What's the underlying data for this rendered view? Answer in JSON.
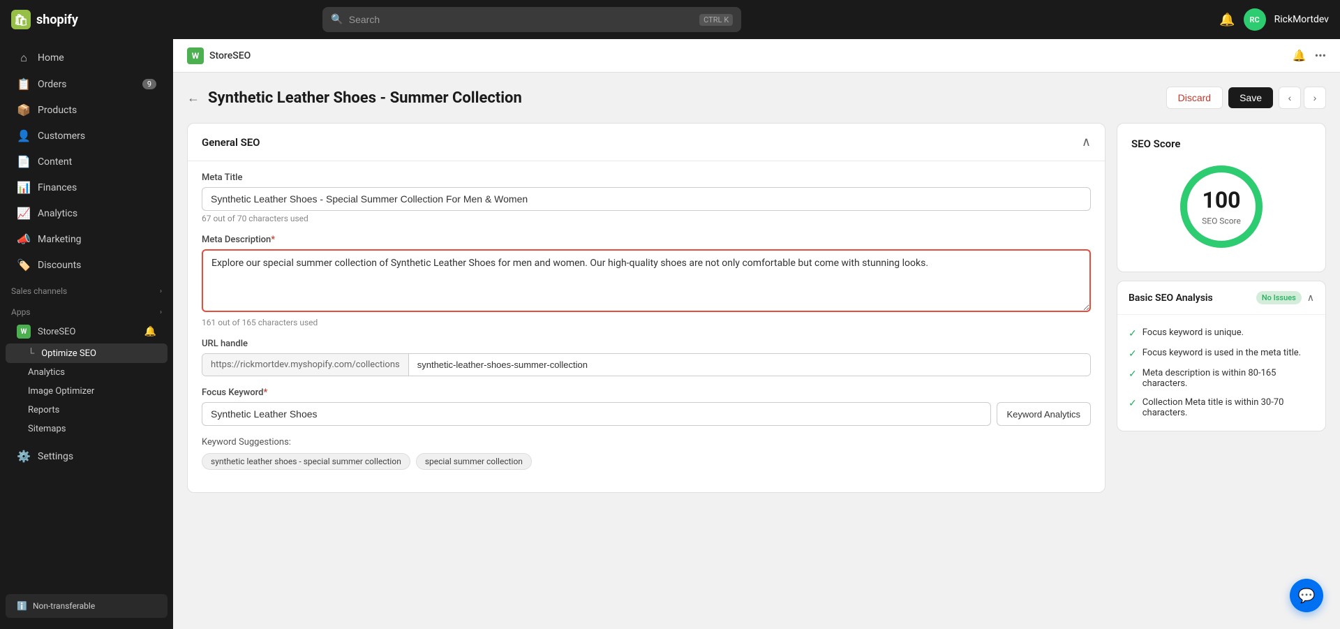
{
  "topbar": {
    "logo_text": "shopify",
    "search_placeholder": "Search",
    "search_shortcut_1": "CTRL",
    "search_shortcut_2": "K",
    "username": "RickMortdev"
  },
  "sidebar": {
    "items": [
      {
        "label": "Home",
        "icon": "⌂",
        "badge": null
      },
      {
        "label": "Orders",
        "icon": "📋",
        "badge": "9"
      },
      {
        "label": "Products",
        "icon": "📦",
        "badge": null
      },
      {
        "label": "Customers",
        "icon": "👤",
        "badge": null
      },
      {
        "label": "Content",
        "icon": "📄",
        "badge": null
      },
      {
        "label": "Finances",
        "icon": "📊",
        "badge": null
      },
      {
        "label": "Analytics",
        "icon": "📈",
        "badge": null
      },
      {
        "label": "Marketing",
        "icon": "📣",
        "badge": null
      },
      {
        "label": "Discounts",
        "icon": "🏷️",
        "badge": null
      }
    ],
    "sales_channels_label": "Sales channels",
    "apps_label": "Apps",
    "store_seo_label": "StoreSEO",
    "sub_items": [
      {
        "label": "Optimize SEO",
        "active": true
      },
      {
        "label": "Analytics",
        "active": false
      },
      {
        "label": "Image Optimizer",
        "active": false
      },
      {
        "label": "Reports",
        "active": false
      },
      {
        "label": "Sitemaps",
        "active": false
      }
    ],
    "settings_label": "Settings",
    "non_transferable_label": "Non-transferable"
  },
  "app_header": {
    "title": "StoreSEO",
    "icon_text": "W"
  },
  "page": {
    "back_arrow": "←",
    "title": "Synthetic Leather Shoes - Summer Collection",
    "discard_label": "Discard",
    "save_label": "Save"
  },
  "general_seo": {
    "section_title": "General SEO",
    "meta_title_label": "Meta Title",
    "meta_title_value": "Synthetic Leather Shoes - Special Summer Collection For Men & Women",
    "meta_title_char_count": "67 out of 70 characters used",
    "meta_desc_label": "Meta Description",
    "meta_desc_required": "*",
    "meta_desc_value": "Explore our special summer collection of Synthetic Leather Shoes for men and women. Our high-quality shoes are not only comfortable but come with stunning looks.",
    "meta_desc_char_count": "161 out of 165 characters used",
    "url_handle_label": "URL handle",
    "url_prefix": "https://rickmortdev.myshopify.com/collections",
    "url_slug": "synthetic-leather-shoes-summer-collection",
    "focus_keyword_label": "Focus Keyword",
    "focus_keyword_required": "*",
    "focus_keyword_value": "Synthetic Leather Shoes",
    "keyword_analytics_btn": "Keyword Analytics",
    "suggestions_label": "Keyword Suggestions:",
    "suggestions": [
      "synthetic leather shoes - special summer collection",
      "special summer collection"
    ]
  },
  "seo_score": {
    "title": "SEO Score",
    "score": "100",
    "score_label": "SEO Score",
    "circle_circumference": 339.292,
    "stroke_dashoffset": 0
  },
  "basic_seo": {
    "title": "Basic SEO Analysis",
    "badge": "No Issues",
    "items": [
      "Focus keyword is unique.",
      "Focus keyword is used in the meta title.",
      "Meta description is within 80-165 characters.",
      "Collection Meta title is within 30-70 characters."
    ]
  }
}
